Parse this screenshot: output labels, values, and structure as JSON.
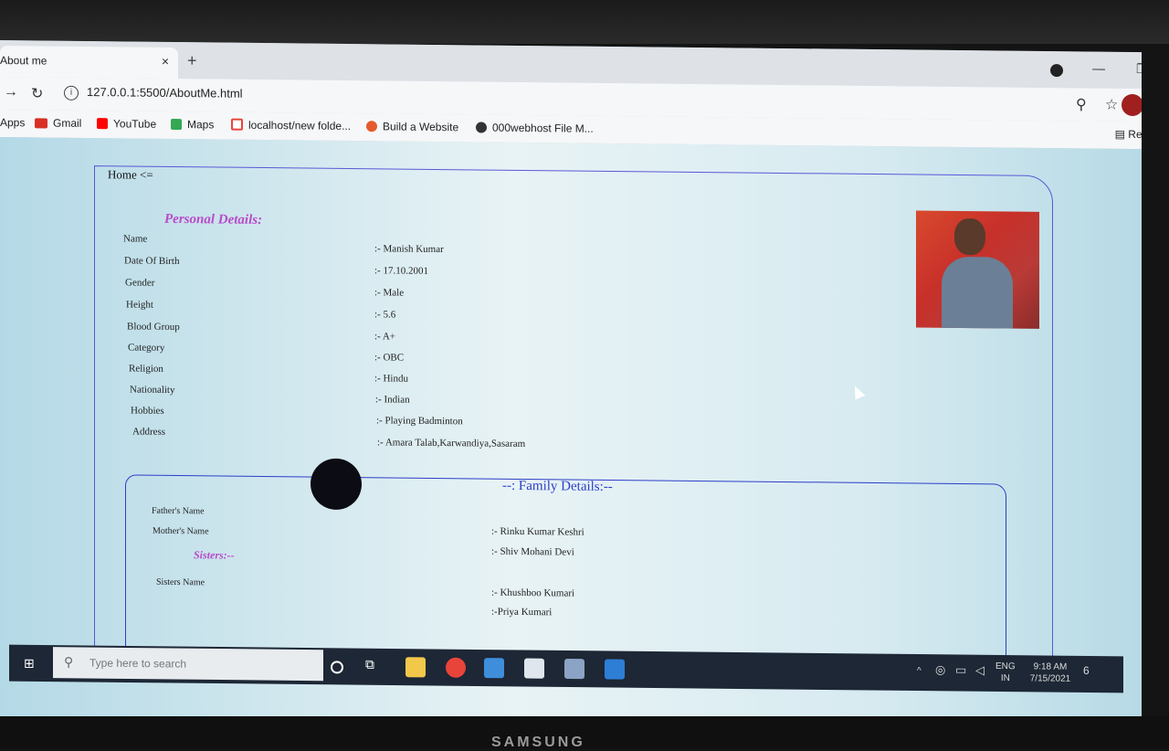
{
  "browser": {
    "tab_title": "About me",
    "tab_close": "×",
    "new_tab": "+",
    "url": "127.0.0.1:5500/AboutMe.html",
    "bookmarks": [
      {
        "label": "Apps",
        "icon": "apps-grid-icon",
        "color": "#4285f4"
      },
      {
        "label": "Gmail",
        "icon": "gmail-icon",
        "color": "#d93025"
      },
      {
        "label": "YouTube",
        "icon": "youtube-icon",
        "color": "#ff0000"
      },
      {
        "label": "Maps",
        "icon": "maps-icon",
        "color": "#34a853"
      },
      {
        "label": "localhost/new folde...",
        "icon": "localhost-icon",
        "color": "#e8453c"
      },
      {
        "label": "Build a Website",
        "icon": "build-website-icon",
        "color": "#e55a2b"
      },
      {
        "label": "000webhost File M...",
        "icon": "webhost-icon",
        "color": "#333333"
      }
    ],
    "reading_list": "Reading"
  },
  "page": {
    "home_link": "Home <=",
    "personal_title": "Personal Details:",
    "personal": [
      {
        "label": "Name",
        "value": ":- Manish Kumar"
      },
      {
        "label": "Date Of Birth",
        "value": ":- 17.10.2001"
      },
      {
        "label": "Gender",
        "value": ":- Male"
      },
      {
        "label": "Height",
        "value": ":- 5.6"
      },
      {
        "label": "Blood Group",
        "value": ":- A+"
      },
      {
        "label": "Category",
        "value": ":- OBC"
      },
      {
        "label": "Religion",
        "value": ":- Hindu"
      },
      {
        "label": "Nationality",
        "value": ":- Indian"
      },
      {
        "label": "Hobbies",
        "value": ":- Playing Badminton"
      },
      {
        "label": "Address",
        "value": ":- Amara Talab,Karwandiya,Sasaram"
      }
    ],
    "family_title": "--: Family Details:--",
    "family": [
      {
        "label": "Father's Name",
        "value": ":- Rinku Kumar Keshri"
      },
      {
        "label": "Mother's Name",
        "value": ":- Shiv Mohani Devi"
      }
    ],
    "sisters_title": "Sisters:--",
    "sisters_label": "Sisters Name",
    "sisters": [
      ":- Khushboo Kumari",
      ":-Priya Kumari"
    ]
  },
  "taskbar": {
    "search_placeholder": "Type here to search",
    "lang_top": "ENG",
    "lang_bottom": "IN",
    "time": "9:18 AM",
    "date": "7/15/2021",
    "notification_count": "6"
  },
  "monitor": {
    "brand": "SAMSUNG"
  },
  "colors": {
    "accent_purple": "#b84ac8",
    "box_blue": "#2c3ec8",
    "page_bg": "#b9dbe6"
  }
}
